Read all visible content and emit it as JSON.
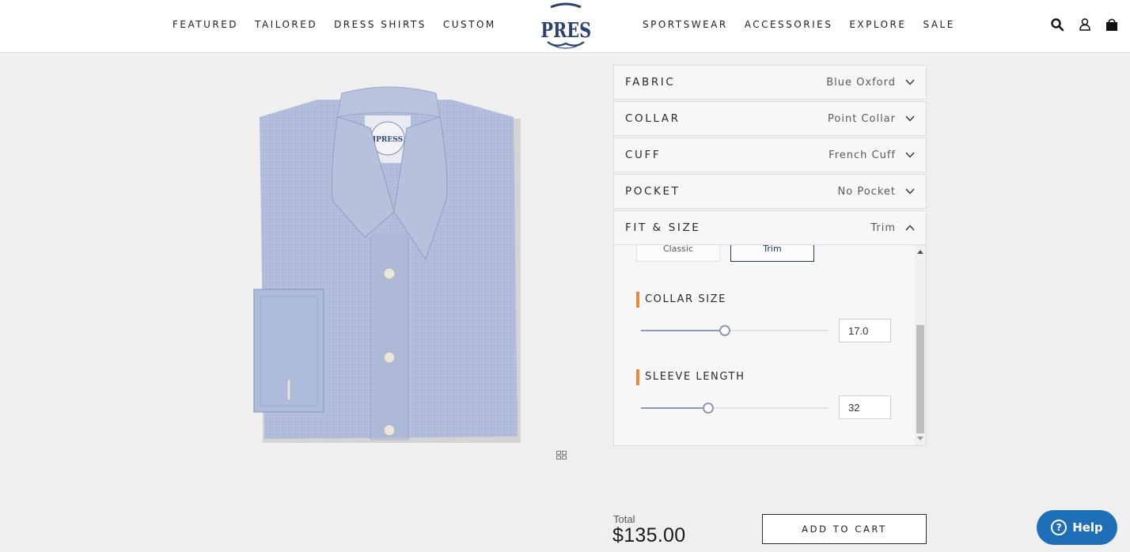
{
  "header": {
    "nav_left": [
      "FEATURED",
      "TAILORED",
      "DRESS SHIRTS",
      "CUSTOM"
    ],
    "nav_right": [
      "SPORTSWEAR",
      "ACCESSORIES",
      "EXPLORE",
      "SALE"
    ],
    "logo_text": "J.PRESS",
    "icons": [
      "search-icon",
      "account-icon",
      "bag-icon"
    ]
  },
  "options": {
    "fabric": {
      "label": "FABRIC",
      "value": "Blue Oxford"
    },
    "collar": {
      "label": "COLLAR",
      "value": "Point Collar"
    },
    "cuff": {
      "label": "CUFF",
      "value": "French Cuff"
    },
    "pocket": {
      "label": "POCKET",
      "value": "No Pocket"
    },
    "fit": {
      "label": "FIT & SIZE",
      "value": "Trim"
    }
  },
  "fit_panel": {
    "fit_options": [
      "Classic",
      "Trim"
    ],
    "selected_fit": "Trim",
    "collar_size": {
      "title": "COLLAR SIZE",
      "value": "17.0",
      "slider_fraction": 0.45
    },
    "sleeve_length": {
      "title": "SLEEVE LENGTH",
      "value": "32",
      "slider_fraction": 0.36
    }
  },
  "summary": {
    "total_label": "Total",
    "total_value": "$135.00",
    "add_to_cart": "ADD TO CART"
  },
  "help": {
    "label": "Help"
  },
  "colors": {
    "accent_orange": "#e88a3a",
    "navy": "#233a5e",
    "help_blue": "#1f6fb8",
    "shirt_blue": "#b3bfdc"
  }
}
